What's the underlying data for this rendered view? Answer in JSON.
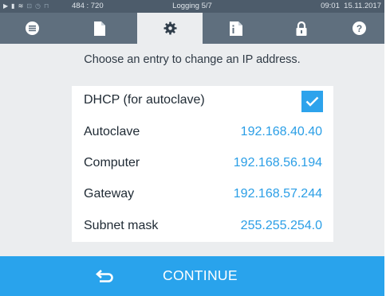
{
  "status_bar": {
    "icons": [
      "play-icon",
      "file-icon",
      "steam-icon",
      "chart-icon",
      "clock-icon",
      "lock-icon"
    ],
    "coords": "484 : 720",
    "logging": "Logging 5/7",
    "time": "09:01",
    "date": "15.11.2017"
  },
  "tabs": [
    {
      "icon": "list-icon",
      "active": false
    },
    {
      "icon": "document-icon",
      "active": false
    },
    {
      "icon": "settings-gear-icon",
      "active": true
    },
    {
      "icon": "info-document-icon",
      "active": false
    },
    {
      "icon": "lock-icon",
      "active": false
    },
    {
      "icon": "help-icon",
      "active": false
    }
  ],
  "prompt": "Choose an entry to change an IP address.",
  "entries": [
    {
      "label": "DHCP (for autoclave)",
      "checked": true
    },
    {
      "label": "Autoclave",
      "value": "192.168.40.40"
    },
    {
      "label": "Computer",
      "value": "192.168.56.194"
    },
    {
      "label": "Gateway",
      "value": "192.168.57.244"
    },
    {
      "label": "Subnet mask",
      "value": "255.255.254.0"
    }
  ],
  "continue_button": {
    "label": "CONTINUE",
    "icon": "back-arrow-icon"
  },
  "colors": {
    "accent": "#29a3ec",
    "status_bar": "#4d5c6b",
    "tab_bar": "#5f6f7e",
    "background": "#ebedef",
    "value_text": "#2a9ee6"
  }
}
